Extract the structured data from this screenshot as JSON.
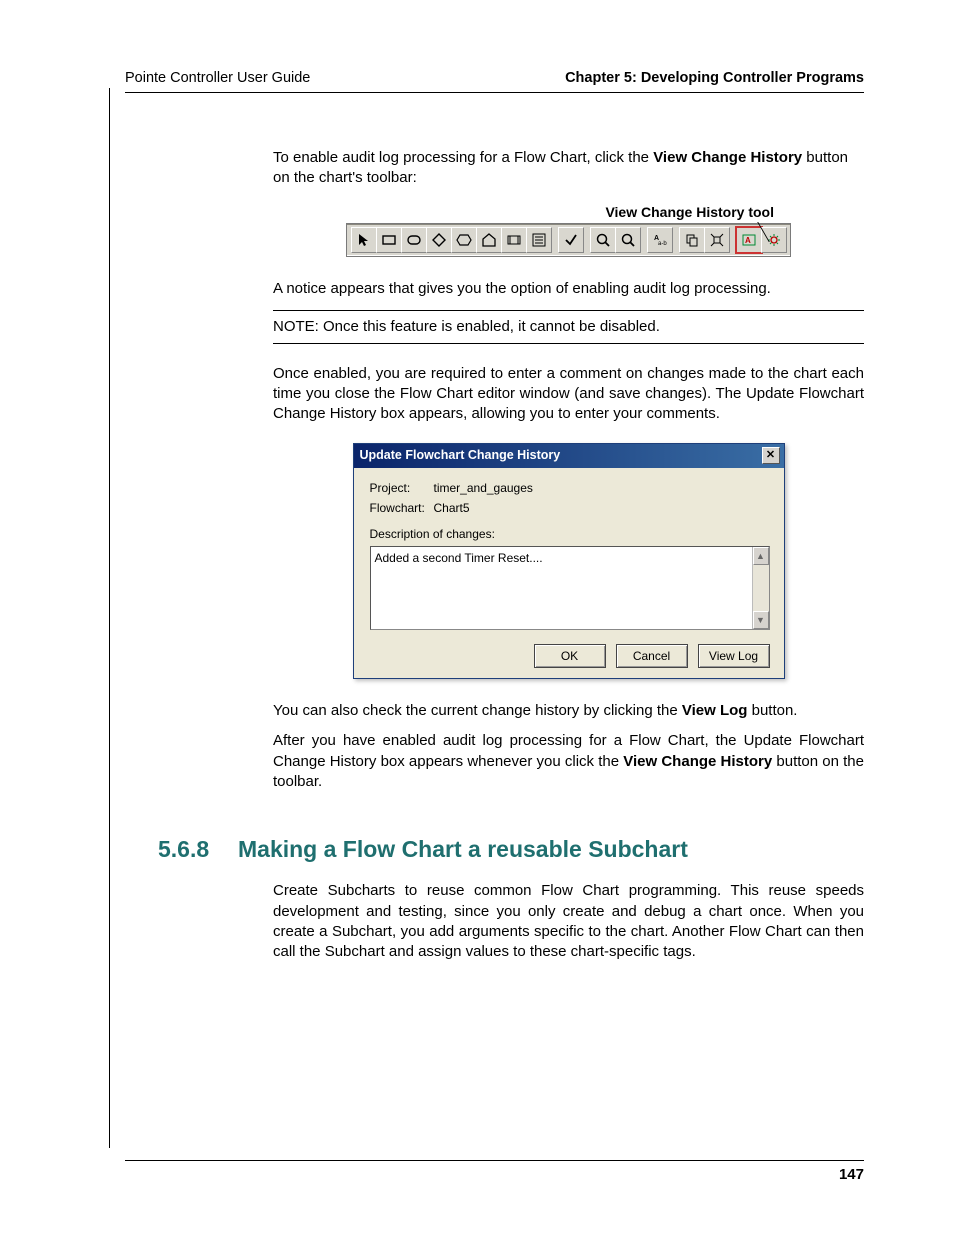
{
  "header": {
    "left": "Pointe Controller User Guide",
    "right": "Chapter 5: Developing Controller Programs"
  },
  "paras": {
    "p1a": "To enable audit log processing for a Flow Chart, click the ",
    "p1b": "View Change History",
    "p1c": " button on the chart's toolbar:",
    "fig_caption": "View Change History tool",
    "p2": "A notice appears that gives you the option of enabling audit log processing.",
    "note": "NOTE: Once this feature is enabled, it cannot be disabled.",
    "p3": "Once enabled, you are required to enter a comment on changes made to the chart each time you close the Flow Chart editor window (and save changes). The Update Flowchart Change History box appears, allowing you to enter your comments.",
    "p4a": "You can also check the current change history by clicking the ",
    "p4b": "View Log",
    "p4c": " button.",
    "p5a": "After you have enabled audit log processing for a Flow Chart, the Update Flowchart Change History box appears whenever you click the ",
    "p5b": "View Change History",
    "p5c": " button on the toolbar."
  },
  "dialog": {
    "title": "Update Flowchart Change History",
    "project_label": "Project:",
    "project_value": "timer_and_gauges",
    "flowchart_label": "Flowchart:",
    "flowchart_value": "Chart5",
    "desc_label": "Description of changes:",
    "textarea_value": "Added a second Timer Reset....",
    "ok": "OK",
    "cancel": "Cancel",
    "viewlog": "View Log"
  },
  "section": {
    "number": "5.6.8",
    "title": "Making a Flow Chart a reusable Subchart",
    "body": "Create Subcharts to reuse common Flow Chart programming. This reuse speeds development and testing, since you only create and debug a chart once. When you create a Subchart, you add arguments specific to the chart. Another Flow Chart can then call the Subchart and assign values to these chart-specific tags."
  },
  "page_number": "147"
}
